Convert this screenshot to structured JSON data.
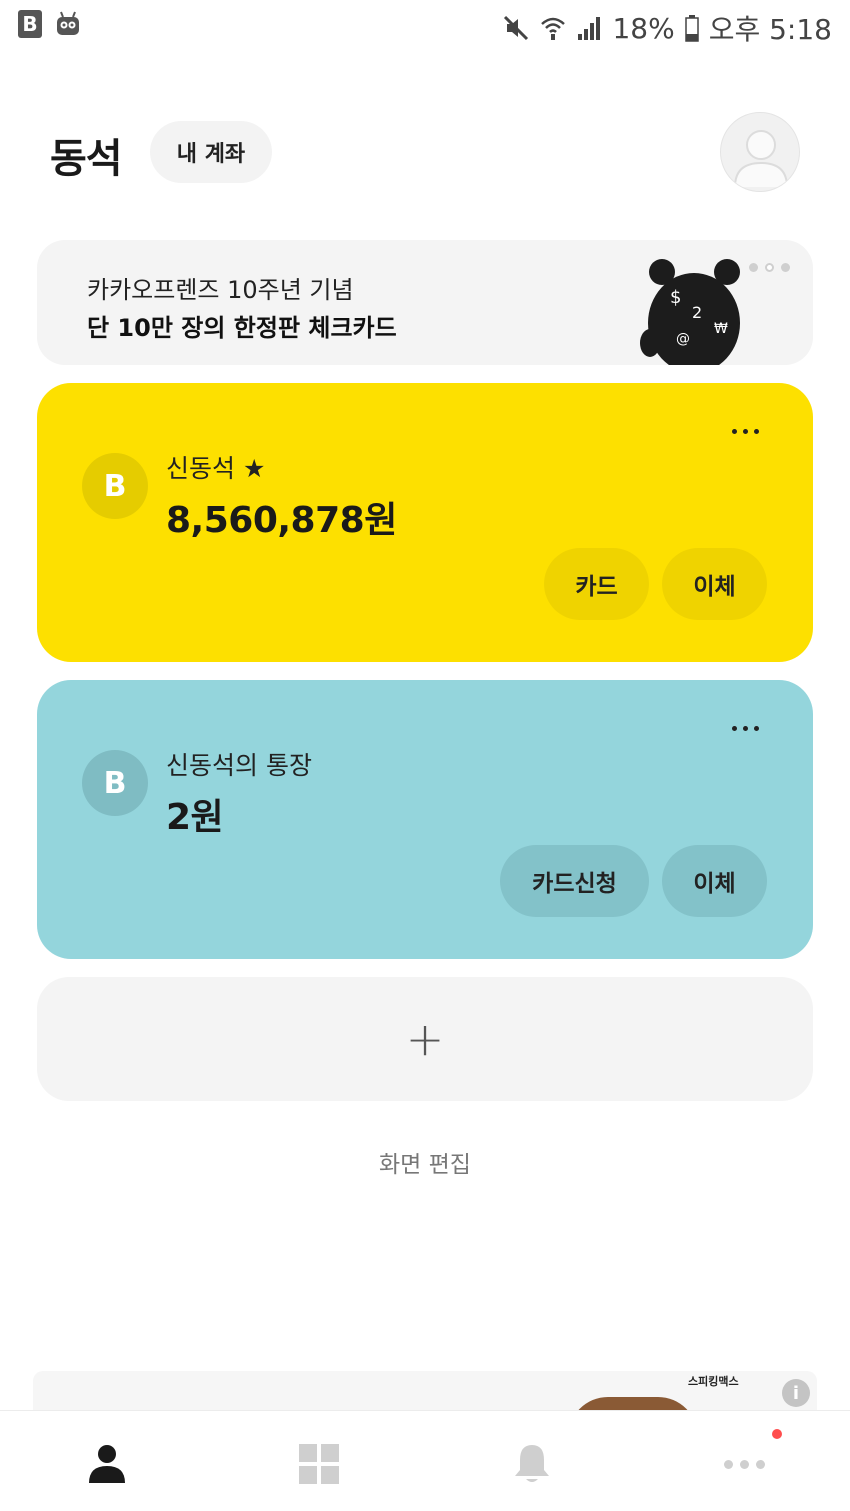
{
  "status_bar": {
    "app_logo": "B",
    "battery": "18%",
    "time": "오후 5:18",
    "icons": [
      "mute-icon",
      "wifi-icon",
      "signal-icon",
      "battery-icon"
    ]
  },
  "header": {
    "user_name": "동석",
    "my_accounts_label": "내 계좌",
    "avatar_icon": "profile-avatar-icon"
  },
  "banner": {
    "line1": "카카오프렌즈 10주년 기념",
    "line2": "단 10만 장의 한정판 체크카드",
    "dots": 3,
    "active_dot": 1
  },
  "accounts": [
    {
      "name": "신동석 ★",
      "balance": "8,560,878원",
      "icon_letter": "B",
      "color": "#fde000",
      "buttons": [
        "카드",
        "이체"
      ]
    },
    {
      "name": "신동석의 통장",
      "balance": "2원",
      "icon_letter": "B",
      "color": "#94d5dc",
      "buttons": [
        "카드신청",
        "이체"
      ]
    }
  ],
  "add_account": {
    "symbol": "+"
  },
  "edit_screen_label": "화면 편집",
  "ad": {
    "label": "스피킹맥스",
    "info_symbol": "i"
  },
  "bottom_nav": {
    "items": [
      "home-person-icon",
      "apps-grid-icon",
      "bell-icon",
      "more-icon"
    ],
    "has_badge_on_more": true
  },
  "colors": {
    "accent_yellow": "#fde000",
    "accent_teal": "#94d5dc",
    "badge_red": "#ff4d4d"
  }
}
